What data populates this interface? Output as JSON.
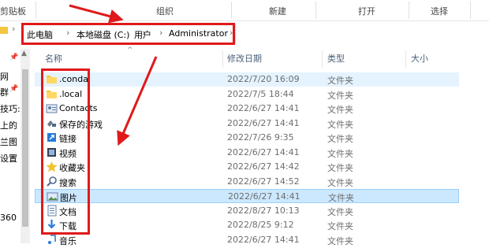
{
  "ribbon": {
    "clipboard": "剪贴板",
    "organize": "组织",
    "new": "新建",
    "open": "打开",
    "select": "选择"
  },
  "address": {
    "crumbs": [
      "此电脑",
      "本地磁盘 (C:)",
      "用户",
      "Administrator"
    ]
  },
  "nav_pane": {
    "items": [
      "网",
      "群",
      "技巧:",
      "上的",
      "兰图",
      "设置",
      "360"
    ]
  },
  "columns": {
    "name": "名称",
    "date": "修改日期",
    "type": "类型",
    "size": "大小"
  },
  "files": [
    {
      "name": ".conda",
      "date": "2022/7/20 16:09",
      "type": "文件夹",
      "icon": "folder-icon"
    },
    {
      "name": ".local",
      "date": "2022/7/5 18:44",
      "type": "文件夹",
      "icon": "folder-icon"
    },
    {
      "name": "Contacts",
      "date": "2022/6/27 14:41",
      "type": "文件夹",
      "icon": "contacts-icon"
    },
    {
      "name": "保存的游戏",
      "date": "2022/6/27 14:41",
      "type": "文件夹",
      "icon": "saved-games-icon"
    },
    {
      "name": "链接",
      "date": "2022/7/26 9:35",
      "type": "文件夹",
      "icon": "links-icon"
    },
    {
      "name": "视频",
      "date": "2022/6/27 14:41",
      "type": "文件夹",
      "icon": "videos-icon"
    },
    {
      "name": "收藏夹",
      "date": "2022/6/27 14:42",
      "type": "文件夹",
      "icon": "favorites-icon"
    },
    {
      "name": "搜索",
      "date": "2022/6/27 14:52",
      "type": "文件夹",
      "icon": "searches-icon"
    },
    {
      "name": "图片",
      "date": "2022/6/27 14:41",
      "type": "文件夹",
      "icon": "pictures-icon"
    },
    {
      "name": "文档",
      "date": "2022/8/27 10:13",
      "type": "文件夹",
      "icon": "documents-icon"
    },
    {
      "name": "下载",
      "date": "2022/8/25 9:12",
      "type": "文件夹",
      "icon": "downloads-icon"
    },
    {
      "name": "音乐",
      "date": "2022/6/27 14:41",
      "type": "文件夹",
      "icon": "music-icon"
    }
  ],
  "colors": {
    "annotation_red": "#e0191b",
    "hover_row": "#e5f3ff",
    "selected_row": "#cce8ff",
    "folder_yellow": "#f4c542"
  }
}
